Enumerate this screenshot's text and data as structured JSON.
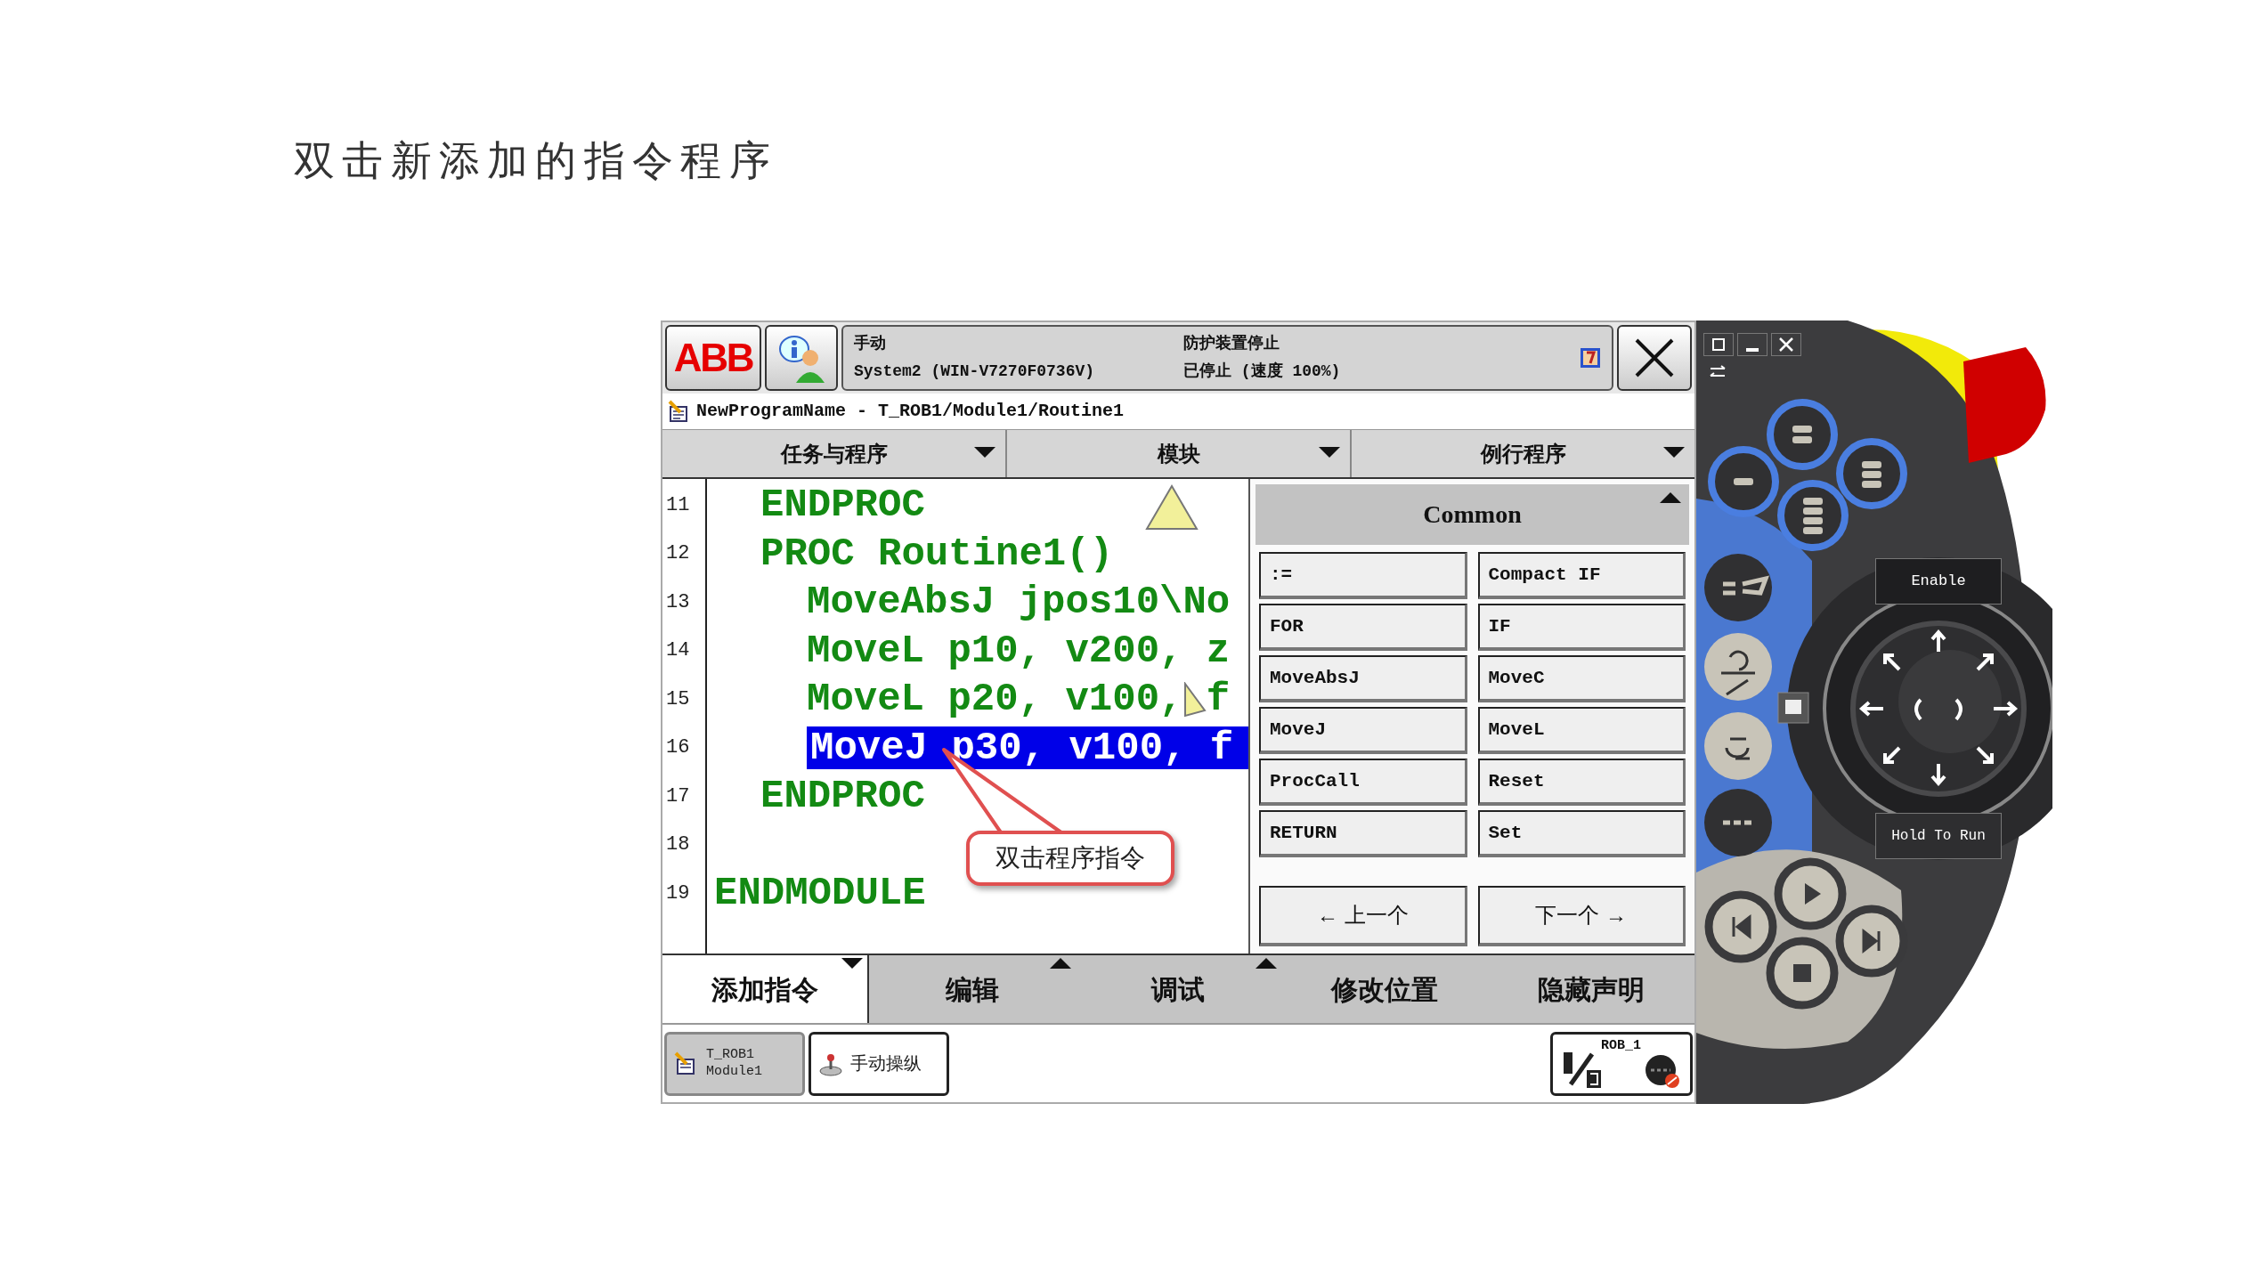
{
  "slide_title": "双击新添加的指令程序",
  "header": {
    "logo": "ABB",
    "status": {
      "mode": "手动",
      "system": "System2 (WIN-V7270F0736V)",
      "safety": "防护装置停止",
      "state": "已停止 (速度 100%)"
    }
  },
  "path": "NewProgramName - T_ROB1/Module1/Routine1",
  "menus": [
    "任务与程序",
    "模块",
    "例行程序"
  ],
  "code": {
    "module_body": [
      {
        "number": "11",
        "text": "ENDPROC",
        "selected": false
      },
      {
        "number": "12",
        "text": "PROC Routine1()",
        "selected": false,
        "children": [
          {
            "number": "13",
            "text": "MoveAbsJ jpos10\\No",
            "selected": false
          },
          {
            "number": "14",
            "text": "MoveL p10, v200, z",
            "selected": false
          },
          {
            "number": "15",
            "text": "MoveL p20, v100, f",
            "selected": false
          },
          {
            "number": "16",
            "text": "MoveJ p30, v100, f",
            "selected": true
          }
        ]
      },
      {
        "number": "17",
        "text": "ENDPROC",
        "selected": false
      },
      {
        "number": "18"
      }
    ],
    "end_line": {
      "number": "19",
      "text": "ENDMODULE",
      "selected": false
    }
  },
  "callout": "双击程序指令",
  "instruction_panel": {
    "title": "Common",
    "instructions": [
      ":=",
      "Compact IF",
      "FOR",
      "IF",
      "MoveAbsJ",
      "MoveC",
      "MoveJ",
      "MoveL",
      "ProcCall",
      "Reset",
      "RETURN",
      "Set"
    ],
    "nav": [
      "← 上一个",
      "下一个 →"
    ]
  },
  "bottom_tabs": [
    {
      "label": "添加指令",
      "selected": true,
      "kind": "dropdown"
    },
    {
      "label": "编辑",
      "selected": false,
      "kind": "popup"
    },
    {
      "label": "调试",
      "selected": false,
      "kind": "popup"
    },
    {
      "label": "修改位置",
      "selected": false,
      "kind": "plain"
    },
    {
      "label": "隐藏声明",
      "selected": false,
      "kind": "plain"
    }
  ],
  "taskbar": {
    "tasks": [
      {
        "kind": "program",
        "title": "T_ROB1",
        "subtitle": "Module1",
        "selected": true
      },
      {
        "kind": "jog",
        "title": "手动操纵",
        "selected": false
      }
    ],
    "robot": "ROB_1"
  },
  "pendant": {
    "enable": "Enable",
    "hold_to_run": "Hold To Run"
  }
}
